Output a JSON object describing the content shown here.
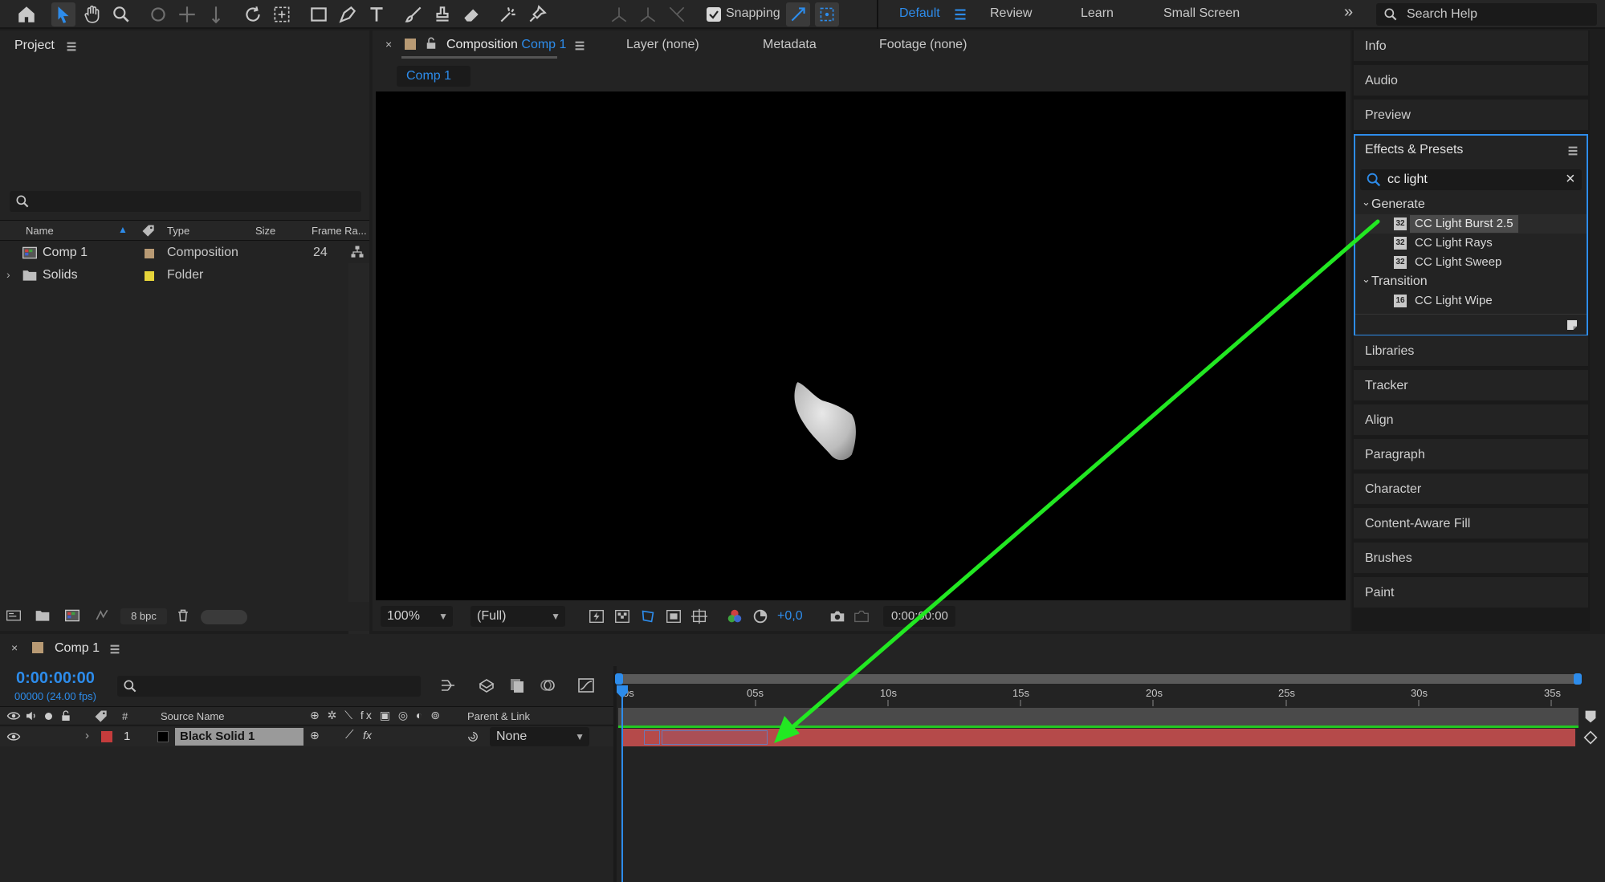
{
  "toolbar": {
    "snapping_label": "Snapping",
    "workspaces": [
      "Default",
      "Review",
      "Learn",
      "Small Screen"
    ],
    "search_help_placeholder": "Search Help"
  },
  "project": {
    "title": "Project",
    "columns": [
      "Name",
      "Type",
      "Size",
      "Frame Ra..."
    ],
    "items": [
      {
        "name": "Comp 1",
        "type": "Composition",
        "frame_rate": "24",
        "label_color": "#b89a74"
      },
      {
        "name": "Solids",
        "type": "Folder",
        "frame_rate": "",
        "label_color": "#e6d43a"
      }
    ],
    "bpc": "8 bpc"
  },
  "viewer": {
    "tabs": {
      "composition_prefix": "Composition",
      "composition_name": "Comp 1",
      "layer": "Layer (none)",
      "metadata": "Metadata",
      "footage": "Footage (none)"
    },
    "comp_subtab": "Comp 1",
    "zoom": "100%",
    "resolution": "(Full)",
    "exposure": "+0,0",
    "timecode": "0:00:00:00"
  },
  "right_panels": {
    "top": [
      "Info",
      "Audio",
      "Preview"
    ],
    "effects": {
      "title": "Effects & Presets",
      "search_value": "cc light",
      "groups": [
        {
          "name": "Generate",
          "items": [
            {
              "name": "CC Light Burst 2.5",
              "bits": "32",
              "selected": true
            },
            {
              "name": "CC Light Rays",
              "bits": "32",
              "selected": false
            },
            {
              "name": "CC Light Sweep",
              "bits": "32",
              "selected": false
            }
          ]
        },
        {
          "name": "Transition",
          "items": [
            {
              "name": "CC Light Wipe",
              "bits": "16",
              "selected": false
            }
          ]
        }
      ]
    },
    "bottom": [
      "Libraries",
      "Tracker",
      "Align",
      "Paragraph",
      "Character",
      "Content-Aware Fill",
      "Brushes",
      "Paint"
    ]
  },
  "timeline": {
    "tab": "Comp 1",
    "timecode": "0:00:00:00",
    "frame_info": "00000 (24.00 fps)",
    "columns": {
      "hash": "#",
      "source_name": "Source Name",
      "parent": "Parent & Link"
    },
    "ruler": [
      "0s",
      "05s",
      "10s",
      "15s",
      "20s",
      "25s",
      "30s",
      "35s"
    ],
    "layer": {
      "number": "1",
      "name": "Black Solid 1",
      "parent": "None",
      "label_color": "#c43c3c"
    }
  },
  "colors": {
    "accent": "#2d8ceb",
    "annotation_arrow": "#22e822",
    "layer_bar": "#b54a4a"
  }
}
